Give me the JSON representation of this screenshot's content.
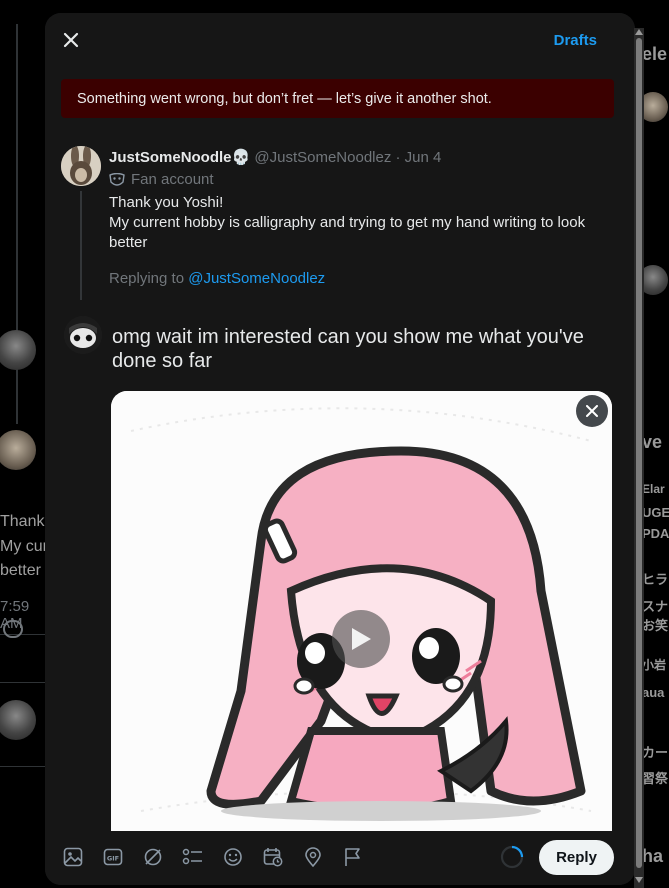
{
  "background": {
    "left_lines": [
      "Thank",
      "My cur",
      "better"
    ],
    "time": "7:59 AM",
    "right_texts": [
      "ele",
      "ve",
      "Elar",
      "UGE",
      "PDA",
      "ヒラ",
      "スナ",
      "お笑",
      "小岩",
      "aua",
      "カー",
      "習祭",
      "ha"
    ]
  },
  "modal": {
    "drafts_label": "Drafts",
    "error_message": "Something went wrong, but don’t fret — let’s give it another shot.",
    "original_tweet": {
      "name": "JustSomeNoodle💀",
      "handle": "@JustSomeNoodlez · Jun 4",
      "fan_label": "Fan account",
      "text_line1": "Thank you Yoshi!",
      "text_line2": "My current hobby is calligraphy and trying to get my hand writing to look better",
      "replying_prefix": "Replying to",
      "replying_mention": "@JustSomeNoodlez"
    },
    "compose_text": "omg wait im interested can you show me what you've done so far",
    "reply_label": "Reply"
  },
  "icons": [
    "close-icon",
    "close-media-icon",
    "play-icon",
    "image-icon",
    "gif-icon",
    "grok-icon",
    "poll-icon",
    "emoji-icon",
    "schedule-icon",
    "location-icon",
    "flag-icon"
  ],
  "colors": {
    "accent": "#1d9bf0",
    "error_bg": "#3b0000",
    "modal_bg": "#161616"
  }
}
